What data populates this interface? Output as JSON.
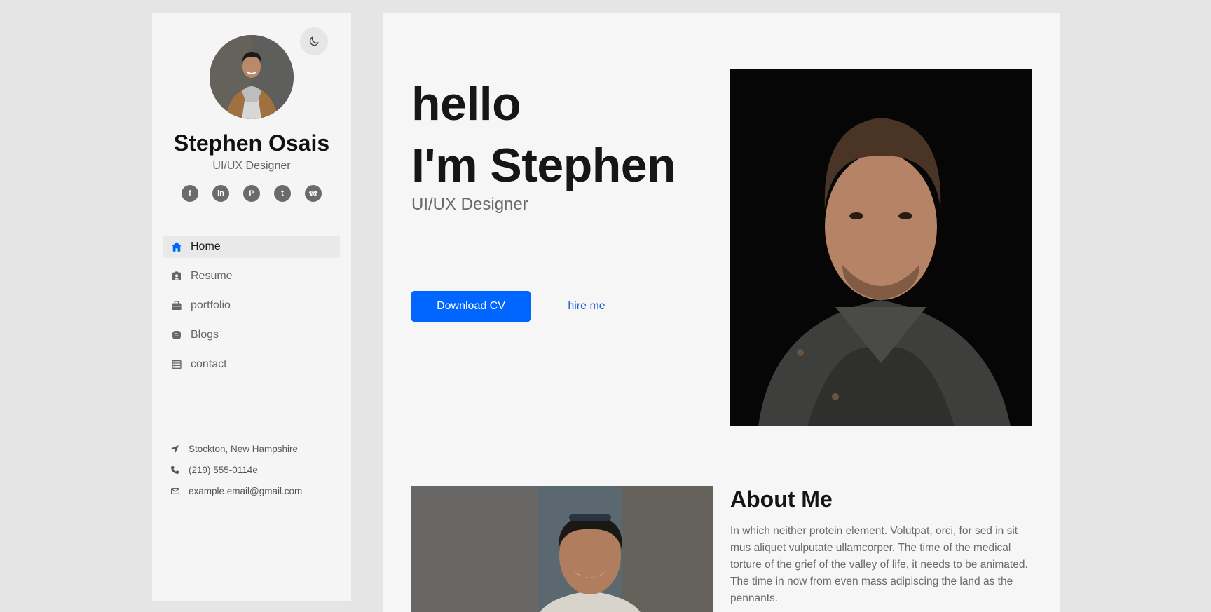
{
  "sidebar": {
    "name": "Stephen Osais",
    "role": "UI/UX Designer",
    "socials": [
      {
        "icon": "facebook-icon",
        "glyph": "f"
      },
      {
        "icon": "linkedin-icon",
        "glyph": "in"
      },
      {
        "icon": "pinterest-icon",
        "glyph": "P"
      },
      {
        "icon": "twitter-icon",
        "glyph": "t"
      },
      {
        "icon": "phone-icon",
        "glyph": "☎"
      }
    ],
    "nav": [
      {
        "label": "Home",
        "icon": "home-icon",
        "active": true
      },
      {
        "label": "Resume",
        "icon": "id-card-icon"
      },
      {
        "label": "portfolio",
        "icon": "briefcase-icon"
      },
      {
        "label": "Blogs",
        "icon": "blog-icon"
      },
      {
        "label": "contact",
        "icon": "table-list-icon"
      }
    ],
    "contact": {
      "location": "Stockton, New Hampshire",
      "phone": "(219) 555-0114e",
      "email": "example.email@gmail.com"
    }
  },
  "hero": {
    "line1": "hello",
    "line2": "I'm Stephen",
    "role": "UI/UX Designer",
    "download_label": "Download CV",
    "hire_label": "hire me"
  },
  "about": {
    "title": "About Me",
    "text": "In which neither protein element. Volutpat, orci, for sed in sit mus aliquet vulputate ullamcorper. The time of the medical torture of the grief of the valley of life, it needs to be animated. The time in now from even mass adipiscing the land as the pennants."
  },
  "colors": {
    "accent": "#0066ff",
    "link": "#1d5fd6",
    "page_bg": "#e5e5e5",
    "panel_bg": "#f5f5f5"
  }
}
